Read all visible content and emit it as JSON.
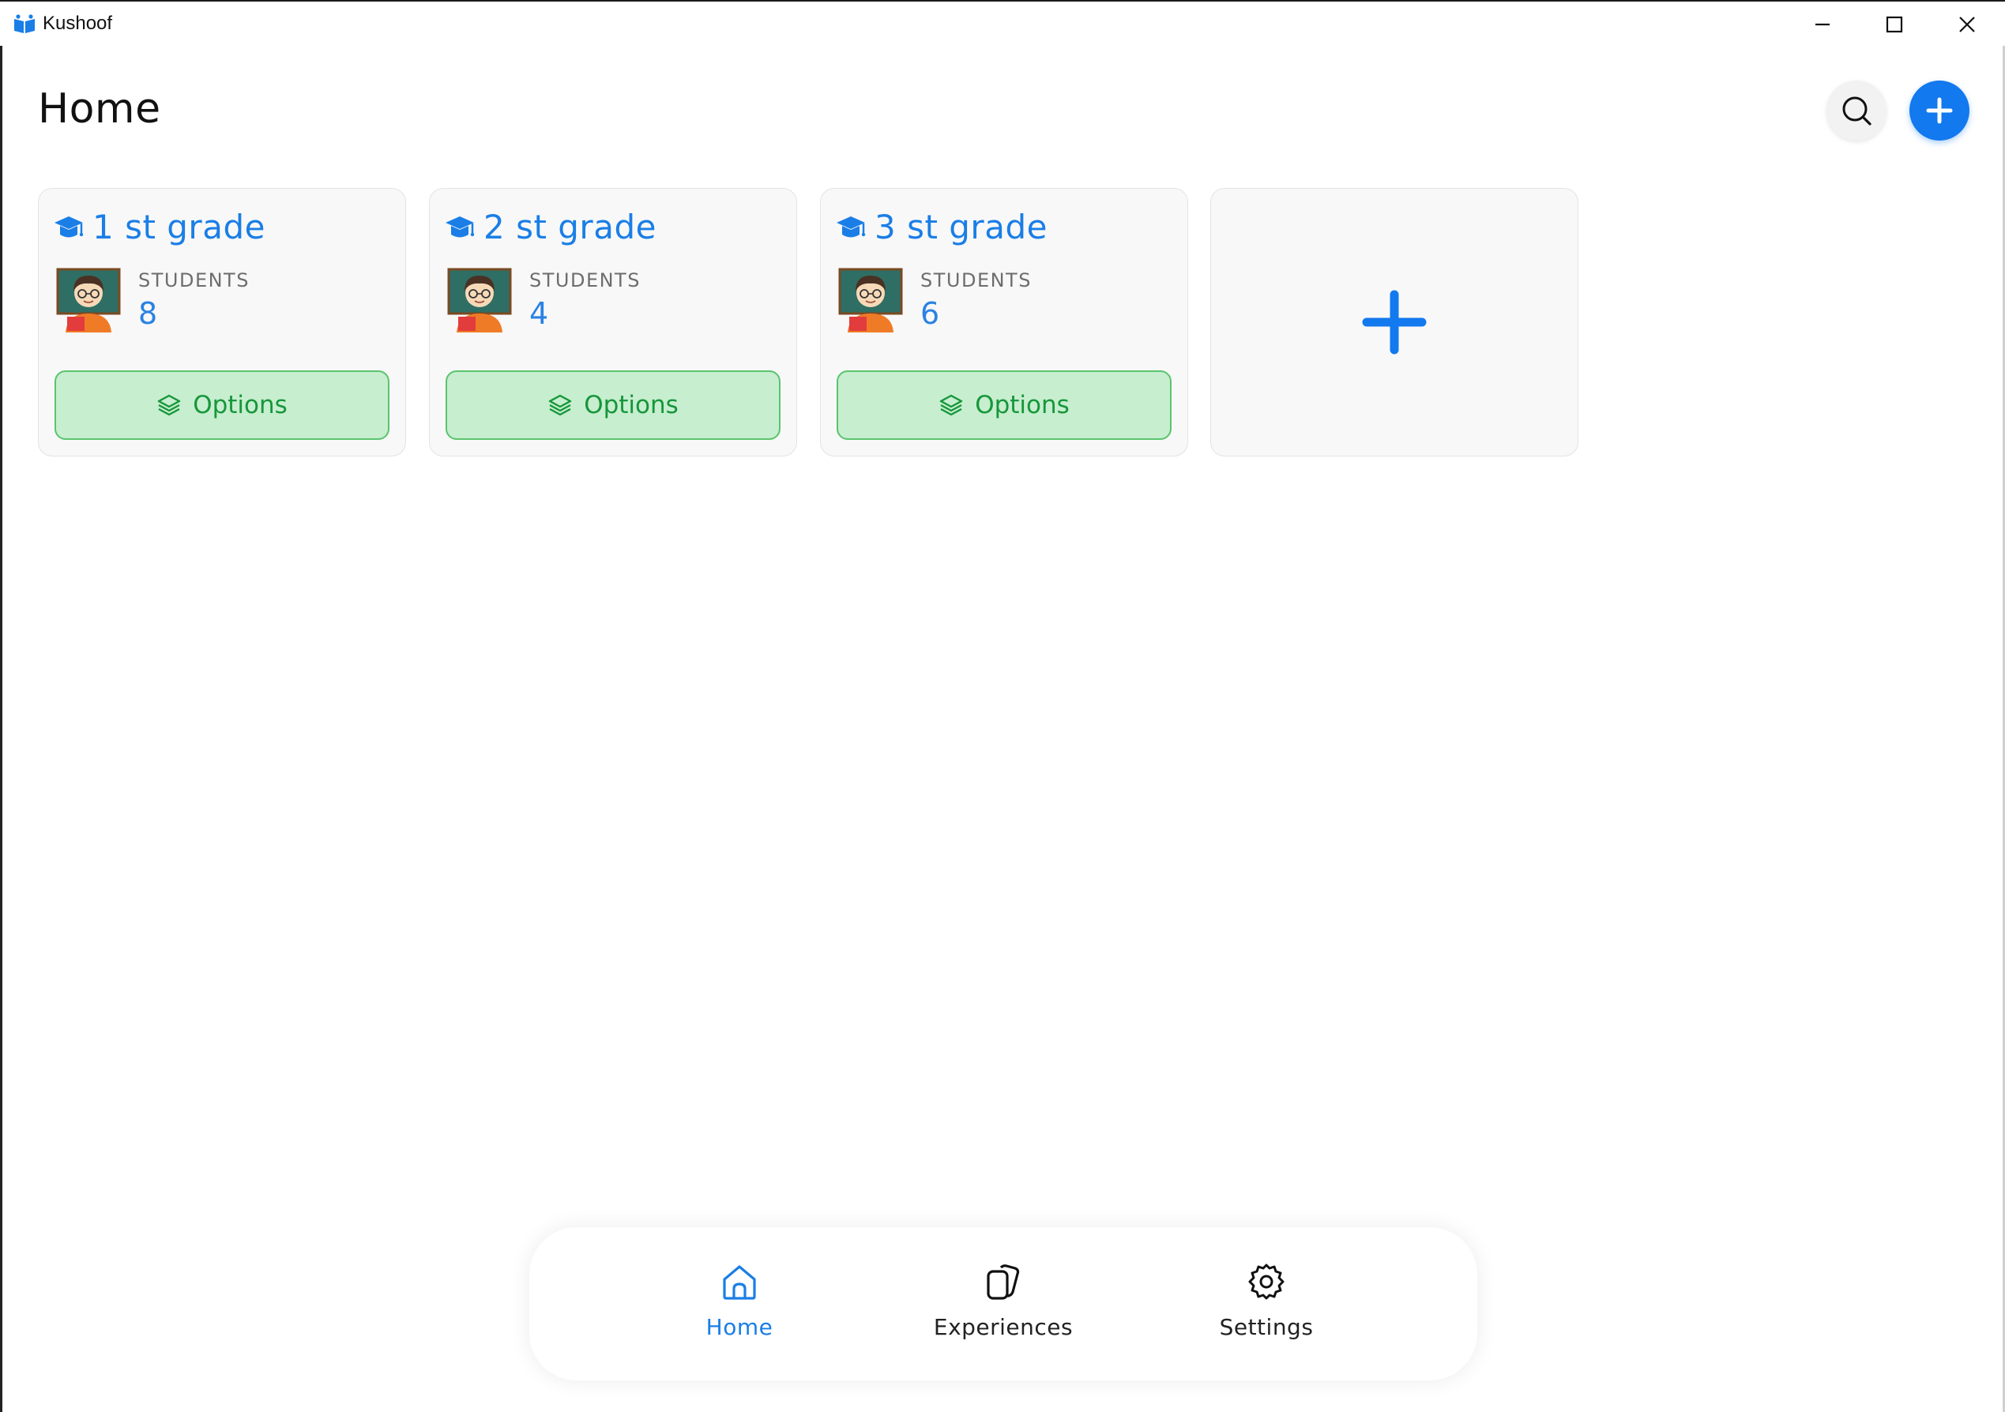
{
  "window": {
    "title": "Kushoof",
    "controls": [
      "minimize-icon",
      "maximize-icon",
      "close-icon"
    ]
  },
  "header": {
    "title": "Home",
    "search_icon": "search-icon",
    "add_icon": "plus-icon"
  },
  "grades": [
    {
      "title": "1 st grade",
      "students_label": "STUDENTS",
      "students_count": "8",
      "options_label": "Options"
    },
    {
      "title": "2 st grade",
      "students_label": "STUDENTS",
      "students_count": "4",
      "options_label": "Options"
    },
    {
      "title": "3 st grade",
      "students_label": "STUDENTS",
      "students_count": "6",
      "options_label": "Options"
    }
  ],
  "add_grade_icon": "plus-icon",
  "bottom_nav": {
    "items": [
      {
        "label": "Home",
        "icon": "home-icon",
        "active": true
      },
      {
        "label": "Experiences",
        "icon": "cards-icon",
        "active": false
      },
      {
        "label": "Settings",
        "icon": "gear-icon",
        "active": false
      }
    ]
  },
  "colors": {
    "accent": "#1279ee",
    "grade_title": "#1a7ee6",
    "options_bg": "#c6eecf",
    "options_border": "#5ac46e",
    "options_text": "#17963a"
  }
}
